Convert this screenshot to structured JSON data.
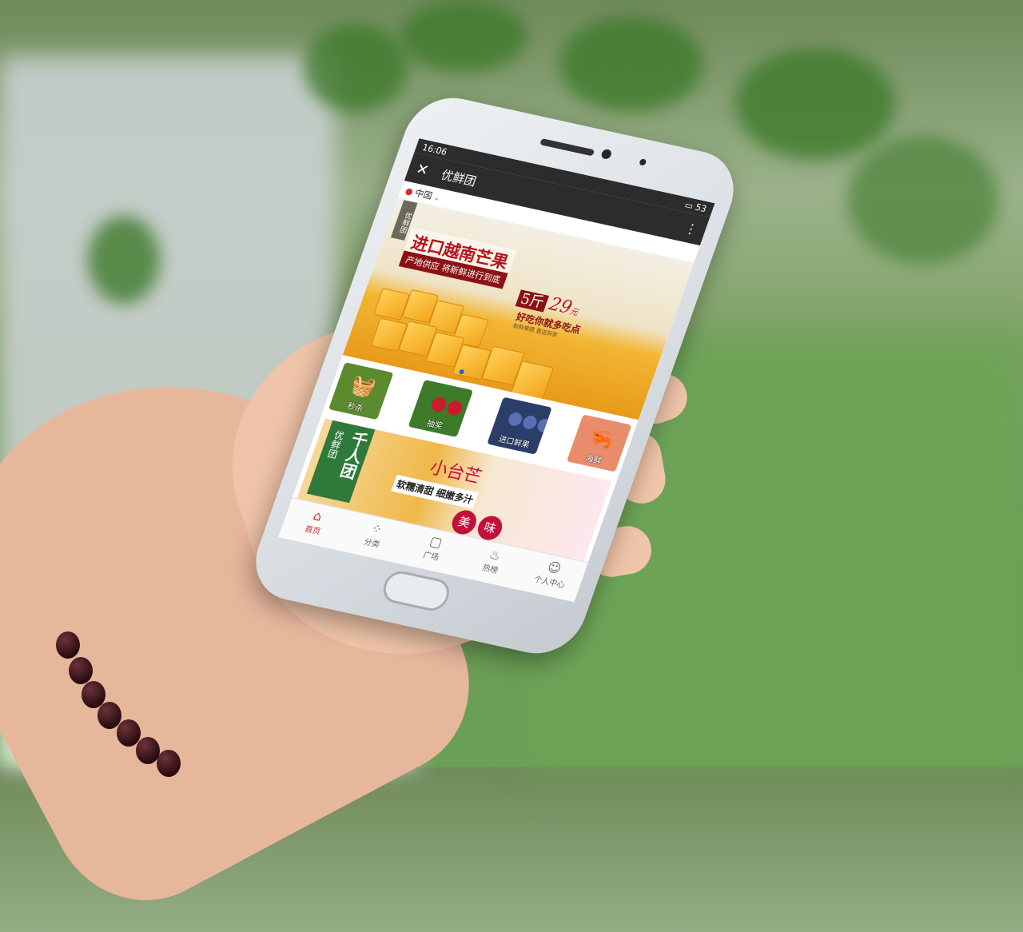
{
  "status_bar": {
    "time": "16:06",
    "battery": "53"
  },
  "app_header": {
    "title": "优鲜团"
  },
  "location": {
    "city": "中国"
  },
  "banner": {
    "tag": "优鲜团",
    "headline": "进口越南芒果",
    "subheadline": "产地供应 将新鲜进行到底",
    "quantity": "5斤",
    "price": "29",
    "price_unit": "元",
    "slogan": "好吃你就多吃点",
    "fine_print": "新鲜果蔬 直送到家"
  },
  "categories": [
    {
      "label": "秒杀",
      "icon": "basket-icon",
      "color": "#5c8a2f"
    },
    {
      "label": "抽奖",
      "icon": "cherry-icon",
      "color": "#3d7a2a"
    },
    {
      "label": "进口鲜果",
      "icon": "blueberry-icon",
      "color": "#2b3d6b"
    },
    {
      "label": "海鲜",
      "icon": "shrimp-icon",
      "color": "#e98c6c"
    }
  ],
  "promo": {
    "badge_brand": "优鲜团",
    "badge_title": "千人团",
    "title": "小台芒",
    "description": "软糯清甜 细嫩多汁",
    "accent_1": "美",
    "accent_2": "味"
  },
  "tabbar": [
    {
      "label": "首页",
      "icon": "home-icon",
      "active": true
    },
    {
      "label": "分类",
      "icon": "grid-icon",
      "active": false
    },
    {
      "label": "广场",
      "icon": "square-icon",
      "active": false
    },
    {
      "label": "热榜",
      "icon": "fire-icon",
      "active": false
    },
    {
      "label": "个人中心",
      "icon": "person-icon",
      "active": false
    }
  ],
  "colors": {
    "accent": "#d62b2b",
    "header_bg": "#2c2c2c",
    "promo_green": "#2f7a3a",
    "banner_red": "#b8121b"
  }
}
